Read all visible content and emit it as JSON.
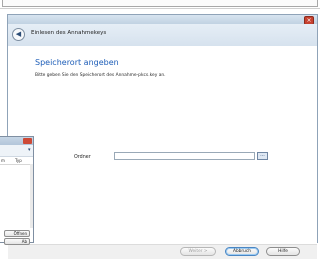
{
  "wizard": {
    "nav_title": "Einlesen des Annahmekeys",
    "heading": "Speicherort angeben",
    "description": "Bitte geben Sie den Speicherort des Annahme-pkcs.key an.",
    "folder_label": "Ordner",
    "folder_value": "",
    "browse_label": "...",
    "buttons": {
      "next": "Weiter >",
      "cancel": "Abbruch",
      "help": "Hilfe"
    },
    "close_glyph": "×",
    "back_glyph": "◀"
  },
  "background_window": {
    "col_name": "m",
    "col_type": "Typ",
    "button_open": "Öffnen",
    "button_cancel": "Ab"
  },
  "colors": {
    "accent_heading": "#1e5eb8",
    "close_red": "#c7412f",
    "dialog_frame": "#c9d7e4"
  }
}
